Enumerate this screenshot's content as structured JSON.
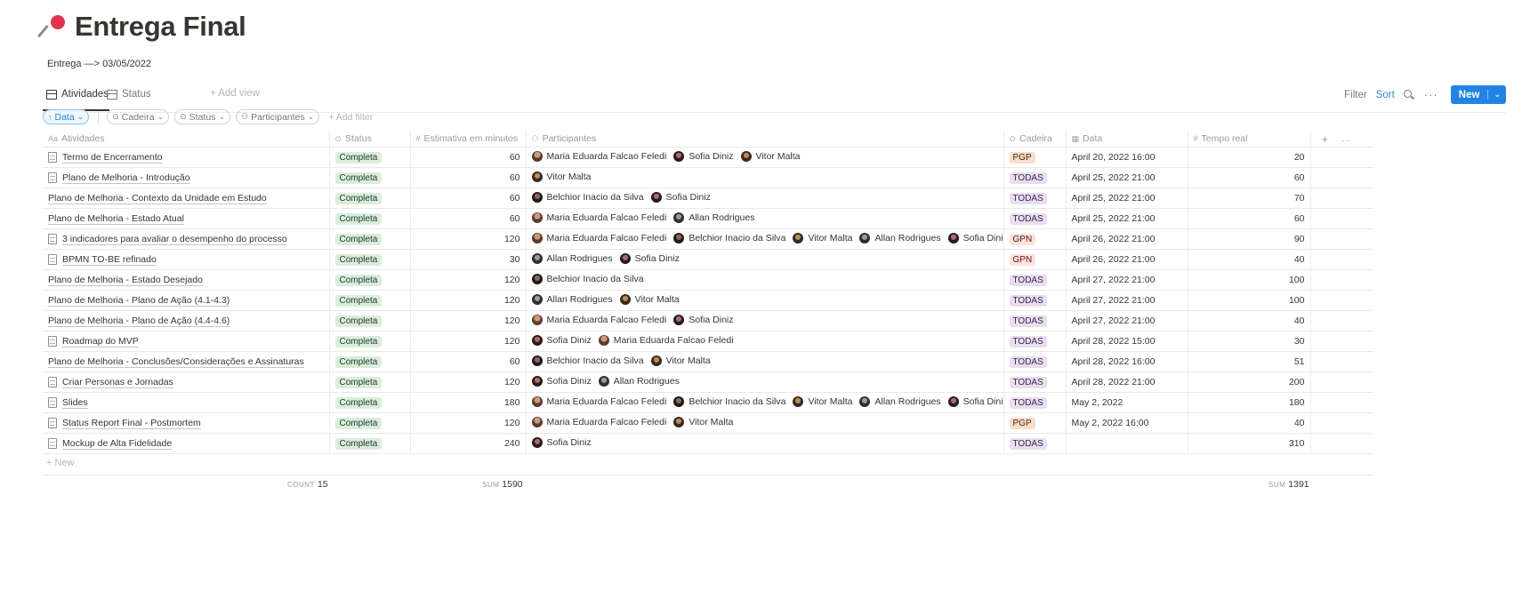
{
  "page": {
    "title": "Entrega Final",
    "icon": "pushpin-icon",
    "subtitle": "Entrega —> 03/05/2022"
  },
  "views": {
    "tabs": [
      "Atividades",
      "Status"
    ],
    "add_view": "+ Add view"
  },
  "toolbar": {
    "filter": "Filter",
    "sort": "Sort",
    "new": "New"
  },
  "filters": {
    "sort_chip": "Data",
    "chips": [
      "Cadeira",
      "Status",
      "Participantes"
    ],
    "add_filter": "+ Add filter"
  },
  "columns": [
    "Atividades",
    "Status",
    "Estimativa em minutos",
    "Participantes",
    "Cadeira",
    "Data",
    "Tempo real"
  ],
  "colors": {
    "accent": "#2383e2",
    "status_bg": "#dbeddb",
    "pgp_bg": "#fadec9",
    "todas_bg": "#e8deee",
    "gpn_bg": "#ffe2dd"
  },
  "rows": [
    {
      "name": "Termo de Encerramento",
      "doc": true,
      "status": "Completa",
      "est": "60",
      "people": [
        "Maria Eduarda Falcao Feledi",
        "Sofia Diniz",
        "Vitor Malta"
      ],
      "cadeira": "PGP",
      "data": "April 20, 2022 16:00",
      "tempo": "20"
    },
    {
      "name": "Plano de Melhoria - Introdução",
      "doc": true,
      "status": "Completa",
      "est": "60",
      "people": [
        "Vitor Malta"
      ],
      "cadeira": "TODAS",
      "data": "April 25, 2022 21:00",
      "tempo": "60"
    },
    {
      "name": "Plano de Melhoria - Contexto da Unidade em Estudo",
      "doc": false,
      "status": "Completa",
      "est": "60",
      "people": [
        "Belchior Inacio da Silva",
        "Sofia Diniz"
      ],
      "cadeira": "TODAS",
      "data": "April 25, 2022 21:00",
      "tempo": "70"
    },
    {
      "name": "Plano de Melhoria - Estado Atual",
      "doc": false,
      "status": "Completa",
      "est": "60",
      "people": [
        "Maria Eduarda Falcao Feledi",
        "Allan Rodrigues"
      ],
      "cadeira": "TODAS",
      "data": "April 25, 2022 21:00",
      "tempo": "60"
    },
    {
      "name": "3 indicadores para avaliar o desempenho do processo",
      "doc": true,
      "status": "Completa",
      "est": "120",
      "people": [
        "Maria Eduarda Falcao Feledi",
        "Belchior Inacio da Silva",
        "Vitor Malta",
        "Allan Rodrigues",
        "Sofia Diniz"
      ],
      "cadeira": "GPN",
      "data": "April 26, 2022 21:00",
      "tempo": "90"
    },
    {
      "name": "BPMN TO-BE refinado",
      "doc": true,
      "status": "Completa",
      "est": "30",
      "people": [
        "Allan Rodrigues",
        "Sofia Diniz"
      ],
      "cadeira": "GPN",
      "data": "April 26, 2022 21:00",
      "tempo": "40"
    },
    {
      "name": "Plano de Melhoria - Estado Desejado",
      "doc": false,
      "status": "Completa",
      "est": "120",
      "people": [
        "Belchior Inacio da Silva"
      ],
      "cadeira": "TODAS",
      "data": "April 27, 2022 21:00",
      "tempo": "100"
    },
    {
      "name": "Plano de Melhoria - Plano de Ação (4.1-4.3)",
      "doc": false,
      "status": "Completa",
      "est": "120",
      "people": [
        "Allan Rodrigues",
        "Vitor Malta"
      ],
      "cadeira": "TODAS",
      "data": "April 27, 2022 21:00",
      "tempo": "100"
    },
    {
      "name": "Plano de Melhoria - Plano de Ação (4.4-4.6)",
      "doc": false,
      "status": "Completa",
      "est": "120",
      "people": [
        "Maria Eduarda Falcao Feledi",
        "Sofia Diniz"
      ],
      "cadeira": "TODAS",
      "data": "April 27, 2022 21:00",
      "tempo": "40"
    },
    {
      "name": "Roadmap do MVP",
      "doc": true,
      "status": "Completa",
      "est": "120",
      "people": [
        "Sofia Diniz",
        "Maria Eduarda Falcao Feledi"
      ],
      "cadeira": "TODAS",
      "data": "April 28, 2022 15:00",
      "tempo": "30"
    },
    {
      "name": "Plano de Melhoria - Conclusões/Considerações e Assinaturas",
      "doc": false,
      "status": "Completa",
      "est": "60",
      "people": [
        "Belchior Inacio da Silva",
        "Vitor Malta"
      ],
      "cadeira": "TODAS",
      "data": "April 28, 2022 16:00",
      "tempo": "51"
    },
    {
      "name": "Criar Personas e Jornadas",
      "doc": true,
      "status": "Completa",
      "est": "120",
      "people": [
        "Sofia Diniz",
        "Allan Rodrigues"
      ],
      "cadeira": "TODAS",
      "data": "April 28, 2022 21:00",
      "tempo": "200"
    },
    {
      "name": "Slides",
      "doc": true,
      "status": "Completa",
      "est": "180",
      "people": [
        "Maria Eduarda Falcao Feledi",
        "Belchior Inacio da Silva",
        "Vitor Malta",
        "Allan Rodrigues",
        "Sofia Diniz"
      ],
      "cadeira": "TODAS",
      "data": "May 2, 2022",
      "tempo": "180"
    },
    {
      "name": "Status Report Final - Postmortem",
      "doc": true,
      "status": "Completa",
      "est": "120",
      "people": [
        "Maria Eduarda Falcao Feledi",
        "Vitor Malta"
      ],
      "cadeira": "PGP",
      "data": "May 2, 2022 16:00",
      "tempo": "40"
    },
    {
      "name": "Mockup de Alta Fidelidade",
      "doc": true,
      "status": "Completa",
      "est": "240",
      "people": [
        "Sofia Diniz"
      ],
      "cadeira": "TODAS",
      "data": "",
      "tempo": "310"
    }
  ],
  "new_row": "+ New",
  "footer": {
    "count_label": "COUNT",
    "count": "15",
    "sum_label": "SUM",
    "sum_est": "1590",
    "sum_tempo": "1391"
  }
}
